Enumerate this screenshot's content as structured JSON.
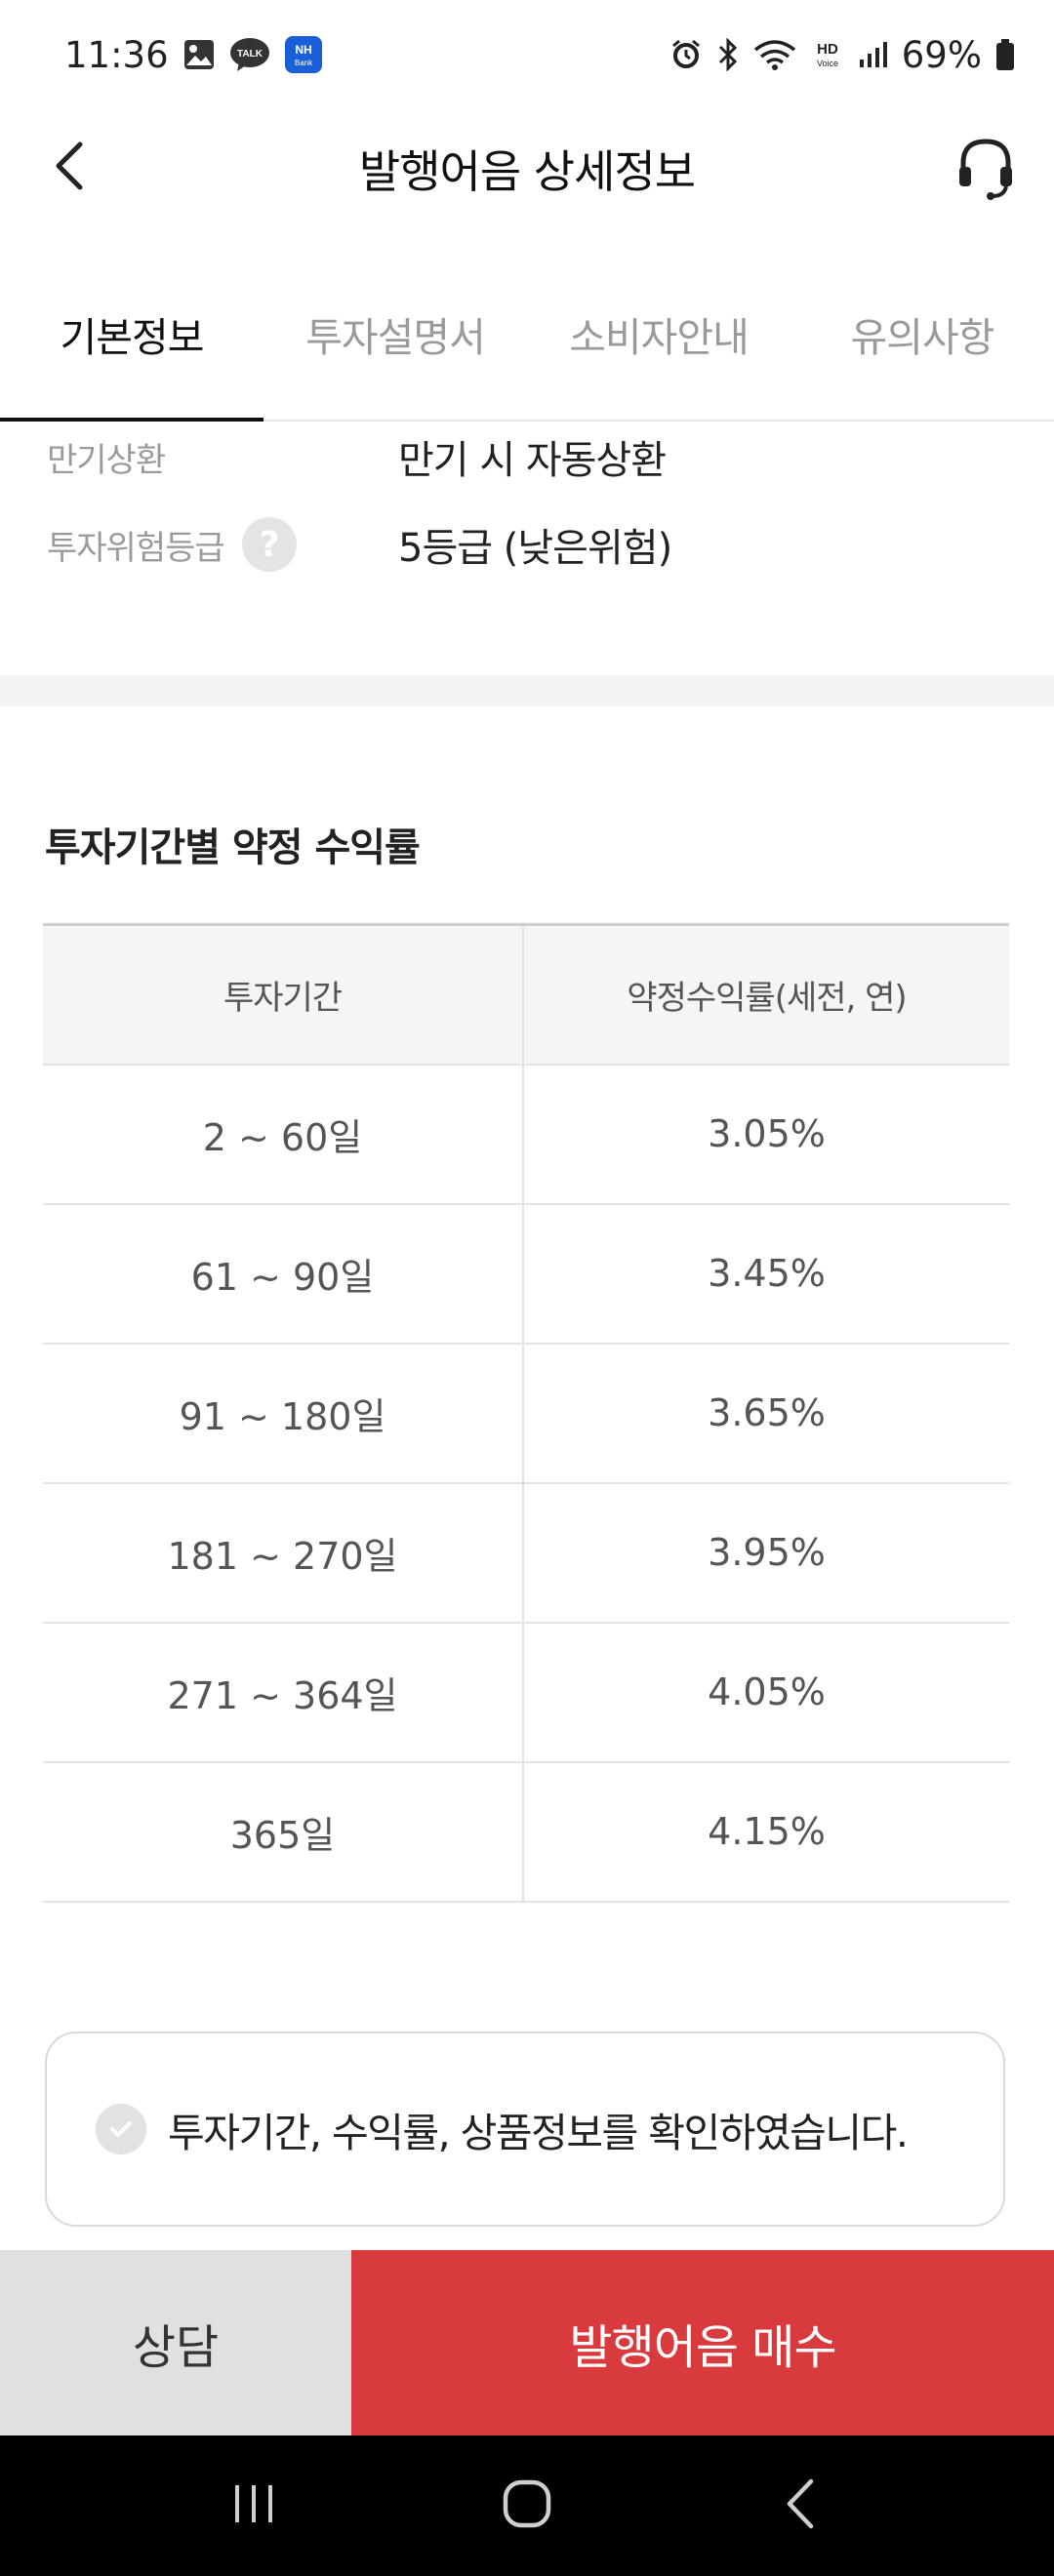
{
  "status_bar": {
    "time": "11:36",
    "talk_badge": "TALK",
    "nh_badge": "NH",
    "nh_badge_sub": "Bank",
    "hd_label": "HD",
    "voice_label": "Voice",
    "battery": "69%",
    "icons": [
      "gallery-icon",
      "talk-icon",
      "nh-bank-icon",
      "alarm-icon",
      "bluetooth-icon",
      "wifi-icon",
      "hd-voice-icon",
      "signal-icon",
      "battery-icon"
    ]
  },
  "header": {
    "title": "발행어음 상세정보",
    "back_icon": "chevron-left-icon",
    "support_icon": "headset-icon"
  },
  "tabs": [
    {
      "label": "기본정보",
      "active": true
    },
    {
      "label": "투자설명서",
      "active": false
    },
    {
      "label": "소비자안내",
      "active": false
    },
    {
      "label": "유의사항",
      "active": false
    }
  ],
  "info": {
    "maturity_label": "만기상환",
    "maturity_value": "만기 시 자동상환",
    "risk_label": "투자위험등급",
    "risk_help": "?",
    "risk_value": "5등급 (낮은위험)"
  },
  "section_title": "투자기간별 약정 수익률",
  "table": {
    "headers": [
      "투자기간",
      "약정수익률(세전, 연)"
    ],
    "rows": [
      [
        "2 ~ 60일",
        "3.05%"
      ],
      [
        "61 ~ 90일",
        "3.45%"
      ],
      [
        "91 ~ 180일",
        "3.65%"
      ],
      [
        "181 ~ 270일",
        "3.95%"
      ],
      [
        "271 ~ 364일",
        "4.05%"
      ],
      [
        "365일",
        "4.15%"
      ]
    ]
  },
  "confirm": {
    "text": "투자기간, 수익률, 상품정보를 확인하였습니다."
  },
  "buttons": {
    "consult": "상담",
    "buy": "발행어음 매수"
  },
  "colors": {
    "accent": "#d93a3e",
    "consult_bg": "#e0e0e0",
    "nav_bg": "#000000"
  }
}
